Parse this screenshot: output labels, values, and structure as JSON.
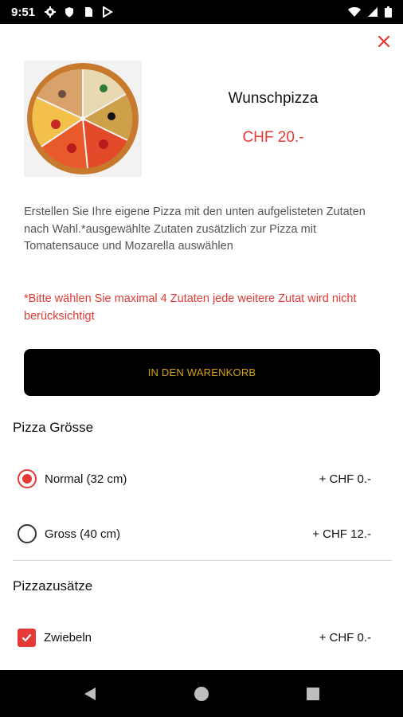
{
  "status_bar": {
    "time": "9:51",
    "left_icons": [
      "gear-icon",
      "shield-icon",
      "sim-card-icon",
      "play-store-icon"
    ],
    "right_icons": [
      "wifi-icon",
      "signal-icon",
      "battery-icon"
    ]
  },
  "product": {
    "title": "Wunschpizza",
    "price": "CHF 20.-",
    "image": "pizza-image",
    "description": "Erstellen Sie Ihre eigene Pizza mit den unten aufgelisteten Zutaten nach Wahl.*ausgewählte Zutaten zusätzlich zur Pizza mit Tomatensauce und Mozarella auswählen",
    "warning": "*Bitte wählen Sie maximal 4 Zutaten jede weitere Zutat wird nicht berücksichtigt"
  },
  "cart_button": {
    "label": "IN DEN WARENKORB"
  },
  "size_section": {
    "title": "Pizza Grösse",
    "options": [
      {
        "label": "Normal (32 cm)",
        "price": "+ CHF 0.-",
        "selected": true
      },
      {
        "label": "Gross (40 cm)",
        "price": "+ CHF 12.-",
        "selected": false
      }
    ]
  },
  "extras_section": {
    "title": "Pizzazusätze",
    "options": [
      {
        "label": "Zwiebeln",
        "price": "+ CHF 0.-",
        "checked": true
      }
    ]
  },
  "colors": {
    "accent": "#e53935",
    "button_bg": "#000000",
    "button_text": "#d4a017"
  },
  "nav_bar": {
    "icons": [
      "back-icon",
      "home-icon",
      "recents-icon"
    ]
  }
}
